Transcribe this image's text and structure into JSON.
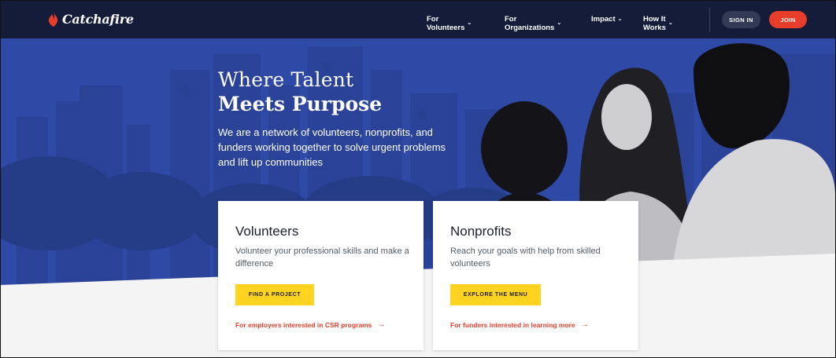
{
  "brand": {
    "name": "Catchafire"
  },
  "nav": {
    "items": [
      {
        "label": "For Volunteers"
      },
      {
        "label": "For Organizations"
      },
      {
        "label": "Impact"
      },
      {
        "label": "How It Works"
      }
    ],
    "sign_in": "SIGN IN",
    "join": "JOIN"
  },
  "hero": {
    "heading_line1": "Where Talent",
    "heading_line2": "Meets Purpose",
    "description": "We are a network of volunteers, nonprofits, and funders working together to solve urgent problems and lift up communities"
  },
  "cards": [
    {
      "title": "Volunteers",
      "text": "Volunteer your professional skills and make a difference",
      "button": "FIND A PROJECT",
      "link": "For employers interested in CSR programs"
    },
    {
      "title": "Nonprofits",
      "text": "Reach your goals with help from skilled volunteers",
      "button": "EXPLORE THE MENU",
      "link": "For funders interested in learning more"
    }
  ],
  "colors": {
    "nav_bg": "#141c3a",
    "hero_blue": "#2f49a6",
    "accent_red": "#e63e2b",
    "button_yellow": "#ffd31f"
  }
}
